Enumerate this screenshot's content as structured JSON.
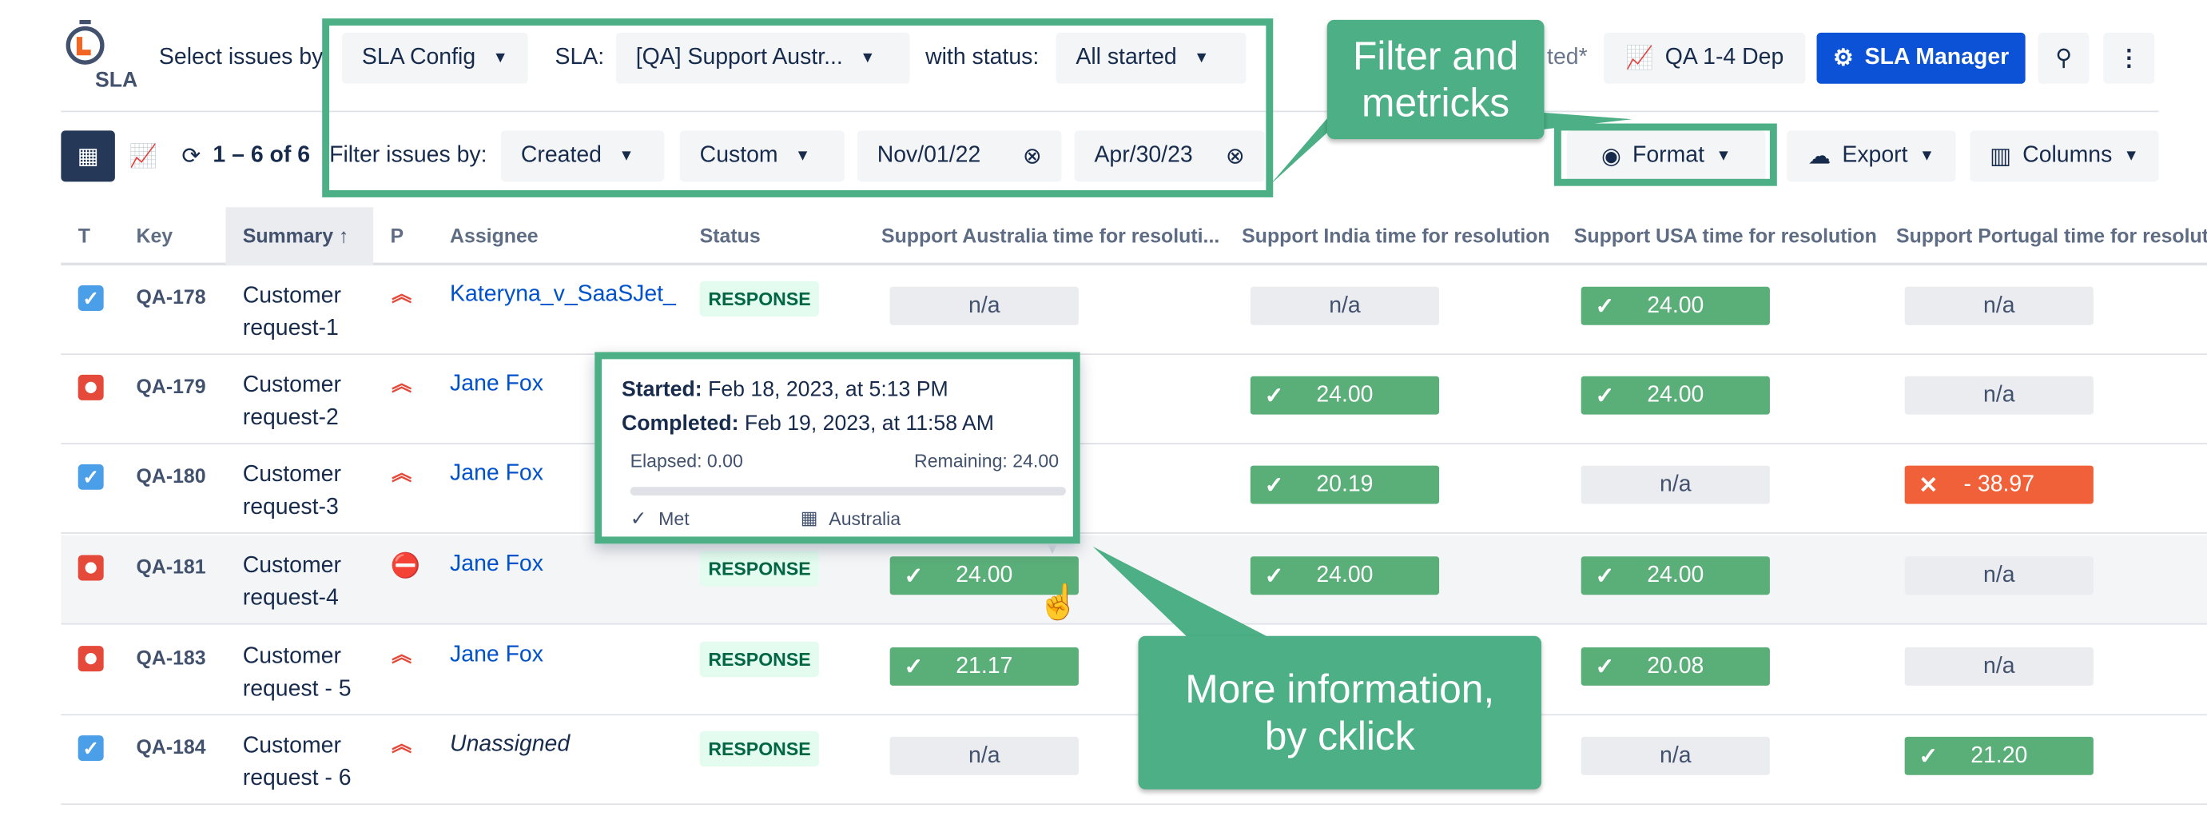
{
  "header": {
    "logo_text": "SLA",
    "select_label": "Select issues by",
    "sla_config": "SLA Config",
    "sla_label": "SLA:",
    "sla_value": "[QA] Support Austr...",
    "status_label": "with status:",
    "status_value": "All started",
    "saved_fragment": "ted*",
    "dashboard_button": "QA 1-4 Dep",
    "sla_manager_button": "SLA Manager"
  },
  "toolbar": {
    "count_text": "1 – 6 of 6",
    "filter_label": "Filter issues by:",
    "filter_field": "Created",
    "filter_range": "Custom",
    "date_from": "Nov/01/22",
    "date_to": "Apr/30/23",
    "format_button": "Format",
    "export_button": "Export",
    "columns_button": "Columns"
  },
  "callouts": {
    "filter": "Filter and metricks",
    "more_info": "More information, by cklick"
  },
  "table": {
    "headers": [
      "T",
      "Key",
      "Summary ↑",
      "P",
      "Assignee",
      "Status",
      "Support Australia time for resoluti...",
      "Support India time for resolution",
      "Support USA time for resolution",
      "Support Portugal time for resolut"
    ],
    "rows": [
      {
        "type": "task",
        "key": "QA-178",
        "summary": [
          "Customer",
          "request-1"
        ],
        "priority": "high",
        "assignee": "Kateryna_v_SaaSJet_",
        "status": "RESPONSE",
        "aus": "n/a",
        "ind": "n/a",
        "usa": "24.00",
        "por": "n/a"
      },
      {
        "type": "bug",
        "key": "QA-179",
        "summary": [
          "Customer",
          "request-2"
        ],
        "priority": "high",
        "assignee": "Jane Fox",
        "status": "",
        "aus": "",
        "ind": "24.00",
        "usa": "24.00",
        "por": "n/a"
      },
      {
        "type": "task",
        "key": "QA-180",
        "summary": [
          "Customer",
          "request-3"
        ],
        "priority": "high",
        "assignee": "Jane Fox",
        "status": "",
        "aus": "",
        "ind": "20.19",
        "usa": "n/a",
        "por": "- 38.97"
      },
      {
        "type": "bug",
        "key": "QA-181",
        "summary": [
          "Customer",
          "request-4"
        ],
        "priority": "blocker",
        "assignee": "Jane Fox",
        "status": "RESPONSE",
        "aus": "24.00",
        "ind": "24.00",
        "usa": "24.00",
        "por": "n/a"
      },
      {
        "type": "bug",
        "key": "QA-183",
        "summary": [
          "Customer",
          "request - 5"
        ],
        "priority": "high",
        "assignee": "Jane Fox",
        "status": "RESPONSE",
        "aus": "21.17",
        "ind": "",
        "usa": "20.08",
        "por": "n/a"
      },
      {
        "type": "task",
        "key": "QA-184",
        "summary": [
          "Customer",
          "request - 6"
        ],
        "priority": "high",
        "assignee": "Unassigned",
        "status": "RESPONSE",
        "aus": "n/a",
        "ind": "",
        "usa": "n/a",
        "por": "21.20"
      }
    ]
  },
  "tooltip": {
    "started_label": "Started:",
    "started_value": "Feb 18, 2023, at 5:13 PM",
    "completed_label": "Completed:",
    "completed_value": "Feb 19, 2023, at 11:58 AM",
    "elapsed": "Elapsed: 0.00",
    "remaining": "Remaining: 24.00",
    "met": "Met",
    "calendar": "Australia"
  },
  "colors": {
    "met": "#5aae78",
    "breach": "#f0613a",
    "frame": "#4caf85",
    "primary": "#0c52d6"
  }
}
